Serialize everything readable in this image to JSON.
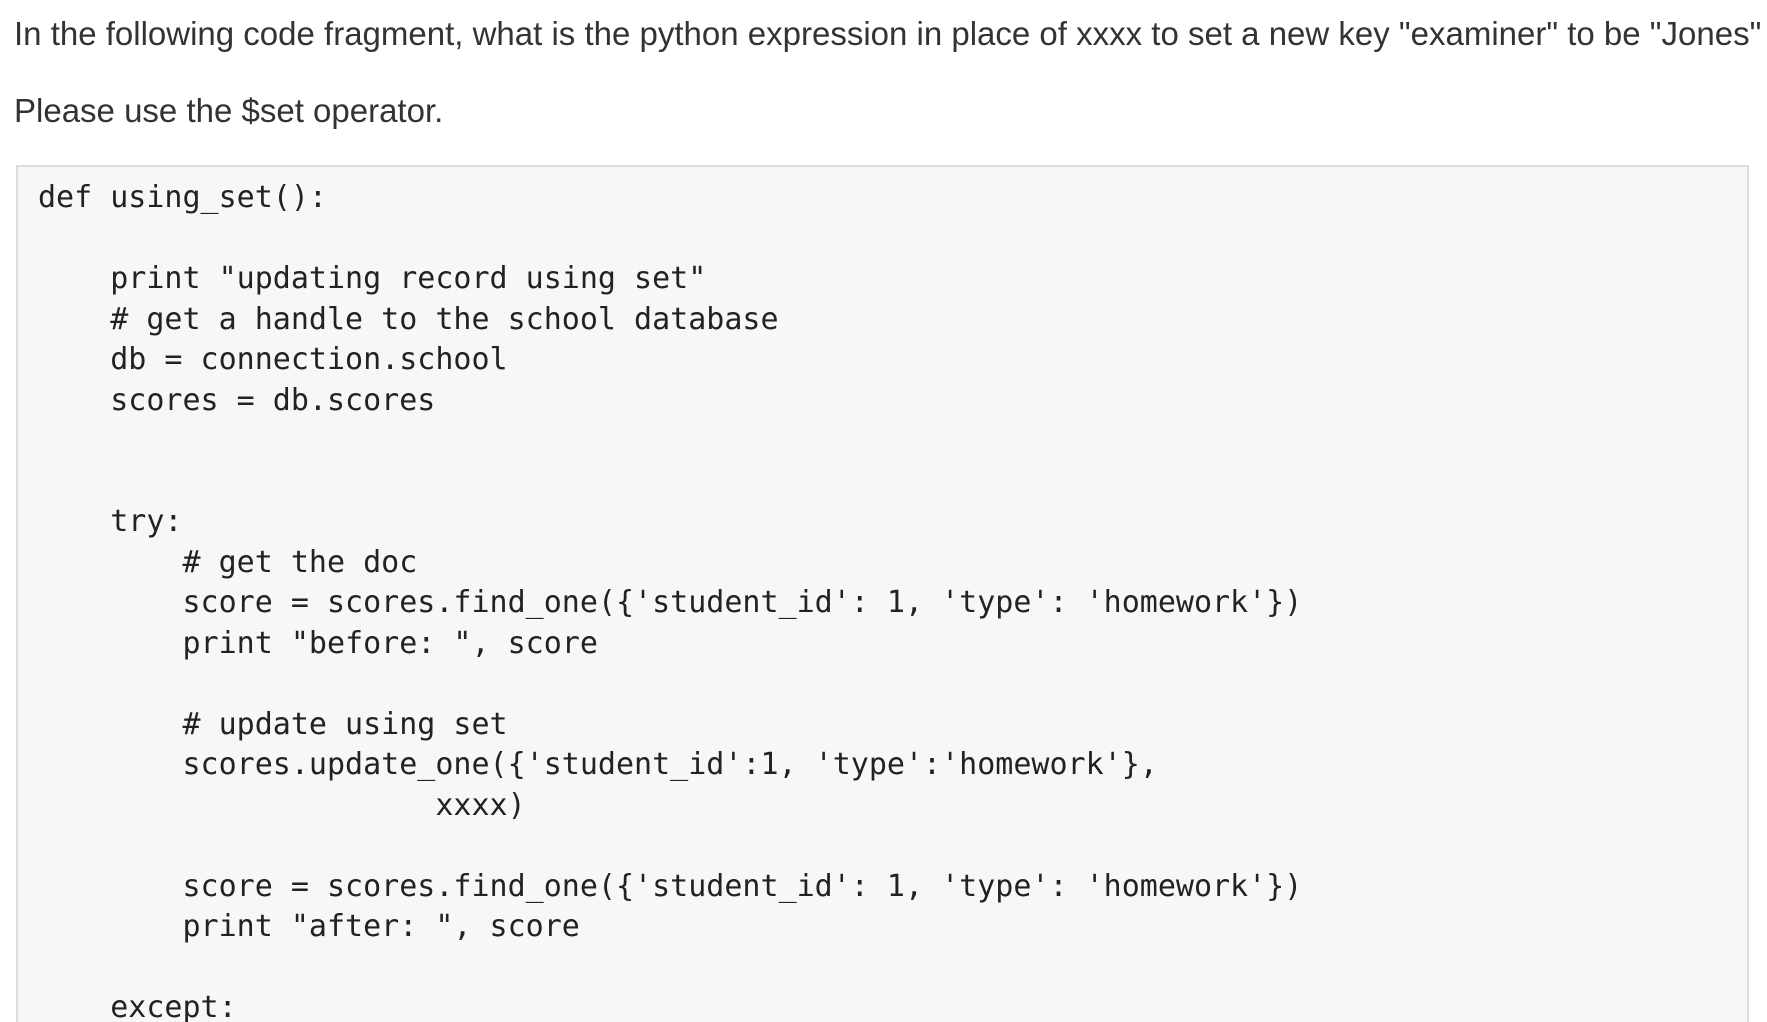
{
  "question": {
    "text": "In the following code fragment, what is the python expression in place of xxxx to set a new key \"examiner\" to be \"Jones\"",
    "instruction": "Please use the $set operator."
  },
  "code": {
    "lines": [
      "def using_set():",
      "",
      "    print \"updating record using set\"",
      "    # get a handle to the school database",
      "    db = connection.school",
      "    scores = db.scores",
      "",
      "",
      "    try:",
      "        # get the doc",
      "        score = scores.find_one({'student_id': 1, 'type': 'homework'})",
      "        print \"before: \", score",
      "",
      "        # update using set",
      "        scores.update_one({'student_id':1, 'type':'homework'},",
      "                      xxxx)",
      "",
      "        score = scores.find_one({'student_id': 1, 'type': 'homework'})",
      "        print \"after: \", score",
      "",
      "    except:"
    ]
  }
}
